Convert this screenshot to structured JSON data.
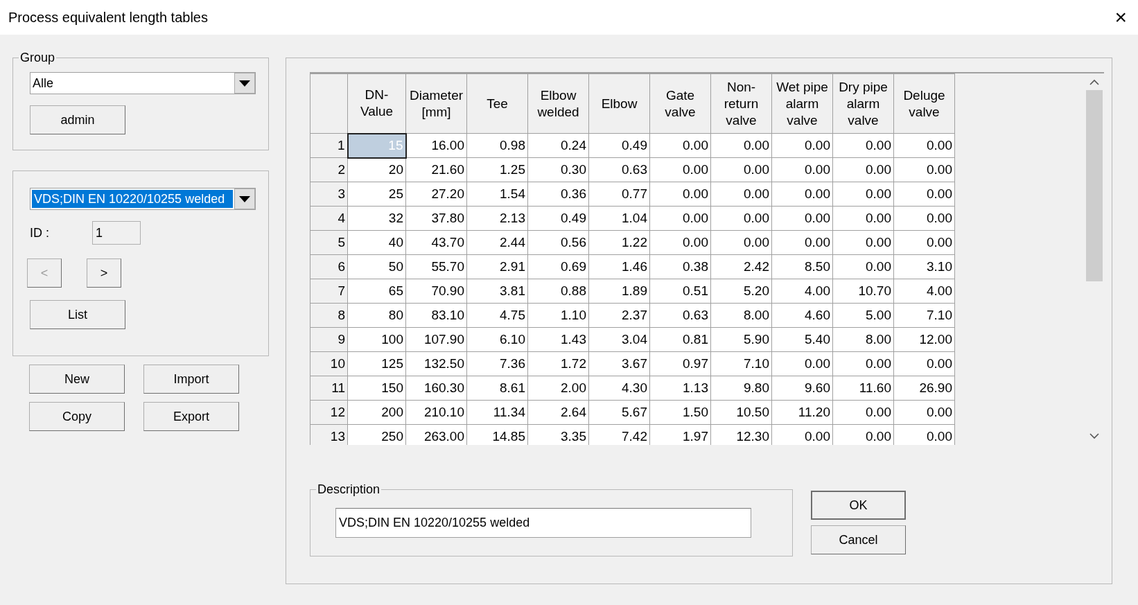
{
  "window": {
    "title": "Process equivalent length tables",
    "close": "×"
  },
  "group": {
    "legend": "Group",
    "dropdown": {
      "value": "Alle",
      "highlighted": false
    },
    "button": {
      "label": "admin",
      "disabled": false
    }
  },
  "table_selector": {
    "dropdown": {
      "value": "VDS;DIN EN 10220/10255 welded",
      "highlighted": true
    },
    "id_label": "ID :",
    "id_value": "1",
    "nav_buttons": [
      {
        "label": "<",
        "disabled": true
      },
      {
        "label": ">",
        "disabled": false
      }
    ],
    "list_button": {
      "label": "List",
      "disabled": false
    }
  },
  "actions": [
    {
      "label": "New",
      "disabled": false
    },
    {
      "label": "Import",
      "disabled": false
    },
    {
      "label": "Copy",
      "disabled": false
    },
    {
      "label": "Export",
      "disabled": false
    }
  ],
  "table": {
    "columns": [
      "DN-\nValue",
      "Diameter\n[mm]",
      "Tee",
      "Elbow\nwelded",
      "Elbow",
      "Gate\nvalve",
      "Non-\nreturn\nvalve",
      "Wet pipe\nalarm\nvalve",
      "Dry pipe\nalarm\nvalve",
      "Deluge\nvalve"
    ],
    "rows": [
      {
        "index": "1",
        "selected": true,
        "cells": [
          "15",
          "16.00",
          "0.98",
          "0.24",
          "0.49",
          "0.00",
          "0.00",
          "0.00",
          "0.00",
          "0.00"
        ]
      },
      {
        "index": "2",
        "selected": false,
        "cells": [
          "20",
          "21.60",
          "1.25",
          "0.30",
          "0.63",
          "0.00",
          "0.00",
          "0.00",
          "0.00",
          "0.00"
        ]
      },
      {
        "index": "3",
        "selected": false,
        "cells": [
          "25",
          "27.20",
          "1.54",
          "0.36",
          "0.77",
          "0.00",
          "0.00",
          "0.00",
          "0.00",
          "0.00"
        ]
      },
      {
        "index": "4",
        "selected": false,
        "cells": [
          "32",
          "37.80",
          "2.13",
          "0.49",
          "1.04",
          "0.00",
          "0.00",
          "0.00",
          "0.00",
          "0.00"
        ]
      },
      {
        "index": "5",
        "selected": false,
        "cells": [
          "40",
          "43.70",
          "2.44",
          "0.56",
          "1.22",
          "0.00",
          "0.00",
          "0.00",
          "0.00",
          "0.00"
        ]
      },
      {
        "index": "6",
        "selected": false,
        "cells": [
          "50",
          "55.70",
          "2.91",
          "0.69",
          "1.46",
          "0.38",
          "2.42",
          "8.50",
          "0.00",
          "3.10"
        ]
      },
      {
        "index": "7",
        "selected": false,
        "cells": [
          "65",
          "70.90",
          "3.81",
          "0.88",
          "1.89",
          "0.51",
          "5.20",
          "4.00",
          "10.70",
          "4.00"
        ]
      },
      {
        "index": "8",
        "selected": false,
        "cells": [
          "80",
          "83.10",
          "4.75",
          "1.10",
          "2.37",
          "0.63",
          "8.00",
          "4.60",
          "5.00",
          "7.10"
        ]
      },
      {
        "index": "9",
        "selected": false,
        "cells": [
          "100",
          "107.90",
          "6.10",
          "1.43",
          "3.04",
          "0.81",
          "5.90",
          "5.40",
          "8.00",
          "12.00"
        ]
      },
      {
        "index": "10",
        "selected": false,
        "cells": [
          "125",
          "132.50",
          "7.36",
          "1.72",
          "3.67",
          "0.97",
          "7.10",
          "0.00",
          "0.00",
          "0.00"
        ]
      },
      {
        "index": "11",
        "selected": false,
        "cells": [
          "150",
          "160.30",
          "8.61",
          "2.00",
          "4.30",
          "1.13",
          "9.80",
          "9.60",
          "11.60",
          "26.90"
        ]
      },
      {
        "index": "12",
        "selected": false,
        "cells": [
          "200",
          "210.10",
          "11.34",
          "2.64",
          "5.67",
          "1.50",
          "10.50",
          "11.20",
          "0.00",
          "0.00"
        ]
      },
      {
        "index": "13",
        "selected": false,
        "cells": [
          "250",
          "263.00",
          "14.85",
          "3.35",
          "7.42",
          "1.97",
          "12.30",
          "0.00",
          "0.00",
          "0.00"
        ]
      }
    ]
  },
  "description": {
    "legend": "Description",
    "value": "VDS;DIN EN 10220/10255 welded"
  },
  "dialog_buttons": [
    {
      "label": "OK",
      "default": true
    },
    {
      "label": "Cancel",
      "default": false
    }
  ]
}
